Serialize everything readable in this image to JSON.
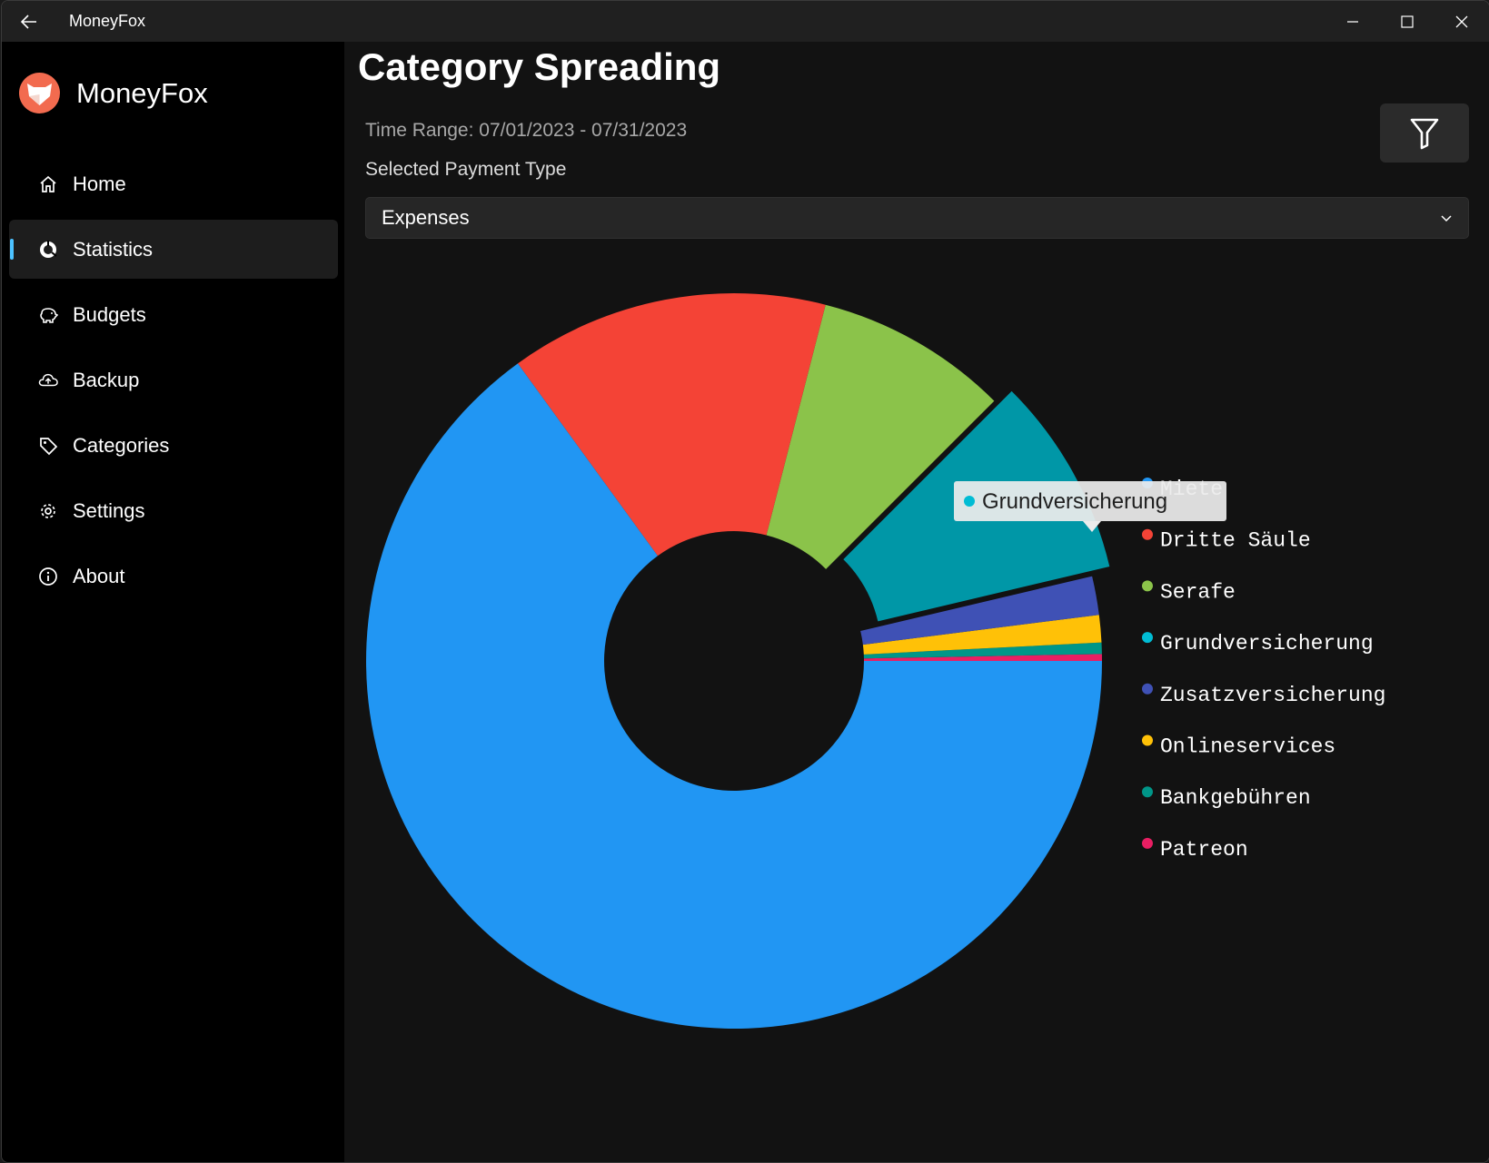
{
  "window": {
    "title": "MoneyFox"
  },
  "sidebar": {
    "brand": "MoneyFox",
    "items": [
      {
        "label": "Home",
        "icon": "home-icon"
      },
      {
        "label": "Statistics",
        "icon": "statistics-icon",
        "selected": true
      },
      {
        "label": "Budgets",
        "icon": "piggy-bank-icon"
      },
      {
        "label": "Backup",
        "icon": "cloud-upload-icon"
      },
      {
        "label": "Categories",
        "icon": "tag-icon"
      },
      {
        "label": "Settings",
        "icon": "gear-icon"
      },
      {
        "label": "About",
        "icon": "info-icon"
      }
    ]
  },
  "main": {
    "title": "Category Spreading",
    "time_range": "Time Range: 07/01/2023 - 07/31/2023",
    "payment_type_label": "Selected Payment Type",
    "payment_type_value": "Expenses"
  },
  "tooltip": {
    "label": "Grundversicherung",
    "color": "#00bcd4"
  },
  "chart_data": {
    "type": "pie",
    "donut": true,
    "title": "",
    "legend_position": "right",
    "categories": [
      "Miete",
      "Dritte Säule",
      "Serafe",
      "Grundversicherung",
      "Zusatzversicherung",
      "Onlineservices",
      "Bankgebühren",
      "Patreon"
    ],
    "values": [
      65.0,
      14.0,
      8.5,
      8.8,
      1.7,
      1.2,
      0.5,
      0.3
    ],
    "colors": [
      "#2196f3",
      "#f44336",
      "#8bc34a",
      "#0097a7",
      "#3f51b5",
      "#ffc107",
      "#009688",
      "#e91e63"
    ],
    "legend_colors": [
      "#2196f3",
      "#f44336",
      "#8bc34a",
      "#00bcd4",
      "#3f51b5",
      "#ffc107",
      "#009688",
      "#e91e63"
    ],
    "highlighted": "Grundversicherung"
  }
}
